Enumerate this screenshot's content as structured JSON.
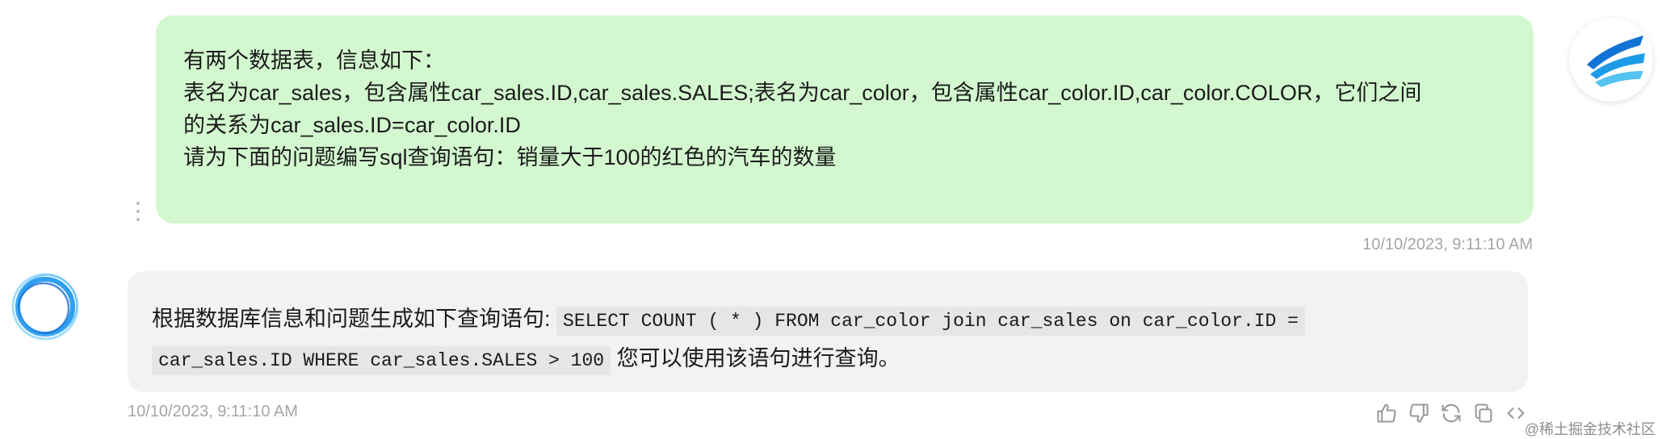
{
  "user_message": {
    "lines": [
      "有两个数据表，信息如下：",
      "表名为car_sales，包含属性car_sales.ID,car_sales.SALES;表名为car_color，包含属性car_color.ID,car_color.COLOR，它们之间",
      "的关系为car_sales.ID=car_color.ID",
      "请为下面的问题编写sql查询语句：销量大于100的红色的汽车的数量"
    ],
    "timestamp": "10/10/2023, 9:11:10 AM"
  },
  "assistant_message": {
    "prefix": "根据数据库信息和问题生成如下查询语句: ",
    "code_line1": "SELECT COUNT ( * ) FROM car_color join car_sales on car_color.ID =",
    "code_line2": "car_sales.ID WHERE car_sales.SALES > 100",
    "suffix": " 您可以使用该语句进行查询。",
    "timestamp": "10/10/2023, 9:11:10 AM"
  },
  "actions": {
    "icons": [
      "thumbs-up-icon",
      "thumbs-down-icon",
      "regenerate-icon",
      "copy-icon",
      "code-icon"
    ]
  },
  "watermark": "@稀土掘金技术社区",
  "colors": {
    "user_bubble": "#d3f8cf",
    "assistant_bubble": "#f2f2f2",
    "code_background": "#e6e6e6",
    "timestamp": "#a6a6a6"
  }
}
